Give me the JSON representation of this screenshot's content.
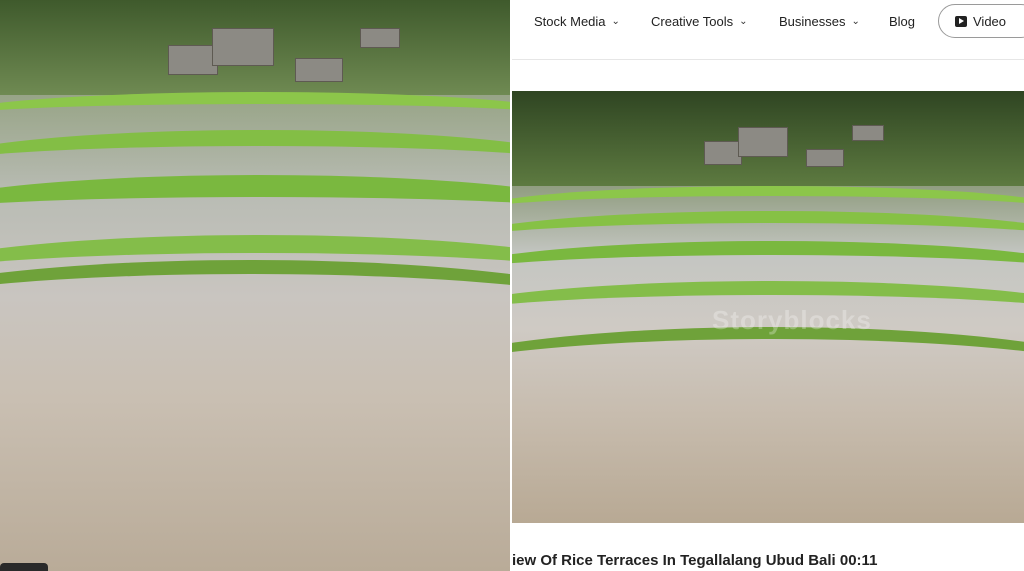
{
  "nav": {
    "items": [
      {
        "label": "Stock Media",
        "has_dropdown": true
      },
      {
        "label": "Creative Tools",
        "has_dropdown": true
      },
      {
        "label": "Businesses",
        "has_dropdown": true
      },
      {
        "label": "Blog",
        "has_dropdown": false
      }
    ],
    "video_button": {
      "label": "Video",
      "icon": "play-icon"
    }
  },
  "media": {
    "watermark": "Storyblocks",
    "caption": "iew Of Rice Terraces In Tegallalang Ubud Bali 00:11"
  },
  "colors": {
    "terrace_green": "#7fbf3f",
    "water": "#c8c4bf",
    "text": "#222222"
  }
}
